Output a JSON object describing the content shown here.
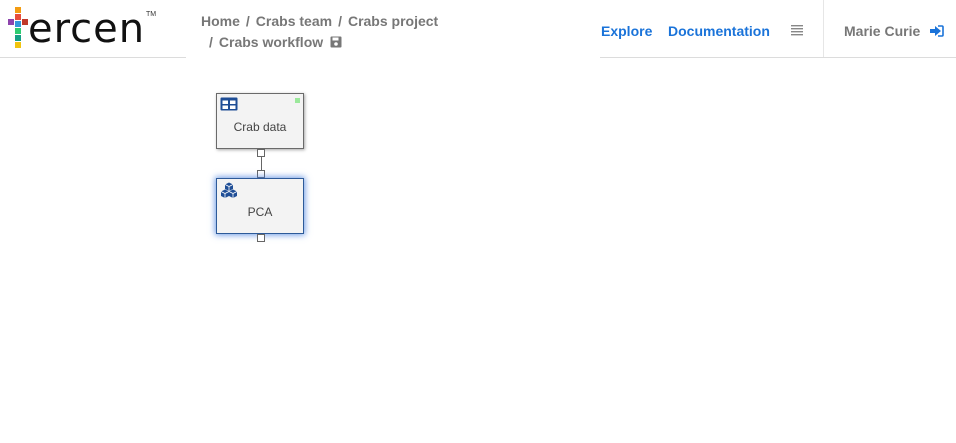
{
  "brand": {
    "logo_text": "ercen",
    "tm": "TM"
  },
  "breadcrumb": {
    "items": [
      "Home",
      "Crabs team",
      "Crabs project",
      "Crabs workflow"
    ],
    "separator": "/"
  },
  "nav": {
    "explore": "Explore",
    "documentation": "Documentation"
  },
  "user": {
    "name": "Marie Curie"
  },
  "colors": {
    "link": "#1a73d9",
    "muted_text": "#777777",
    "selected_node_glow": "#3c78dc",
    "status_ok": "#9be89b"
  },
  "icons": {
    "menu": "hamburger-icon",
    "logout": "logout-icon",
    "save": "save-icon",
    "data_step": "table-icon",
    "operator_step": "cubes-icon"
  },
  "workflow": {
    "steps": [
      {
        "label": "Crab data",
        "kind": "table",
        "status": "done"
      },
      {
        "label": "PCA",
        "kind": "data-step",
        "selected": true
      }
    ]
  }
}
